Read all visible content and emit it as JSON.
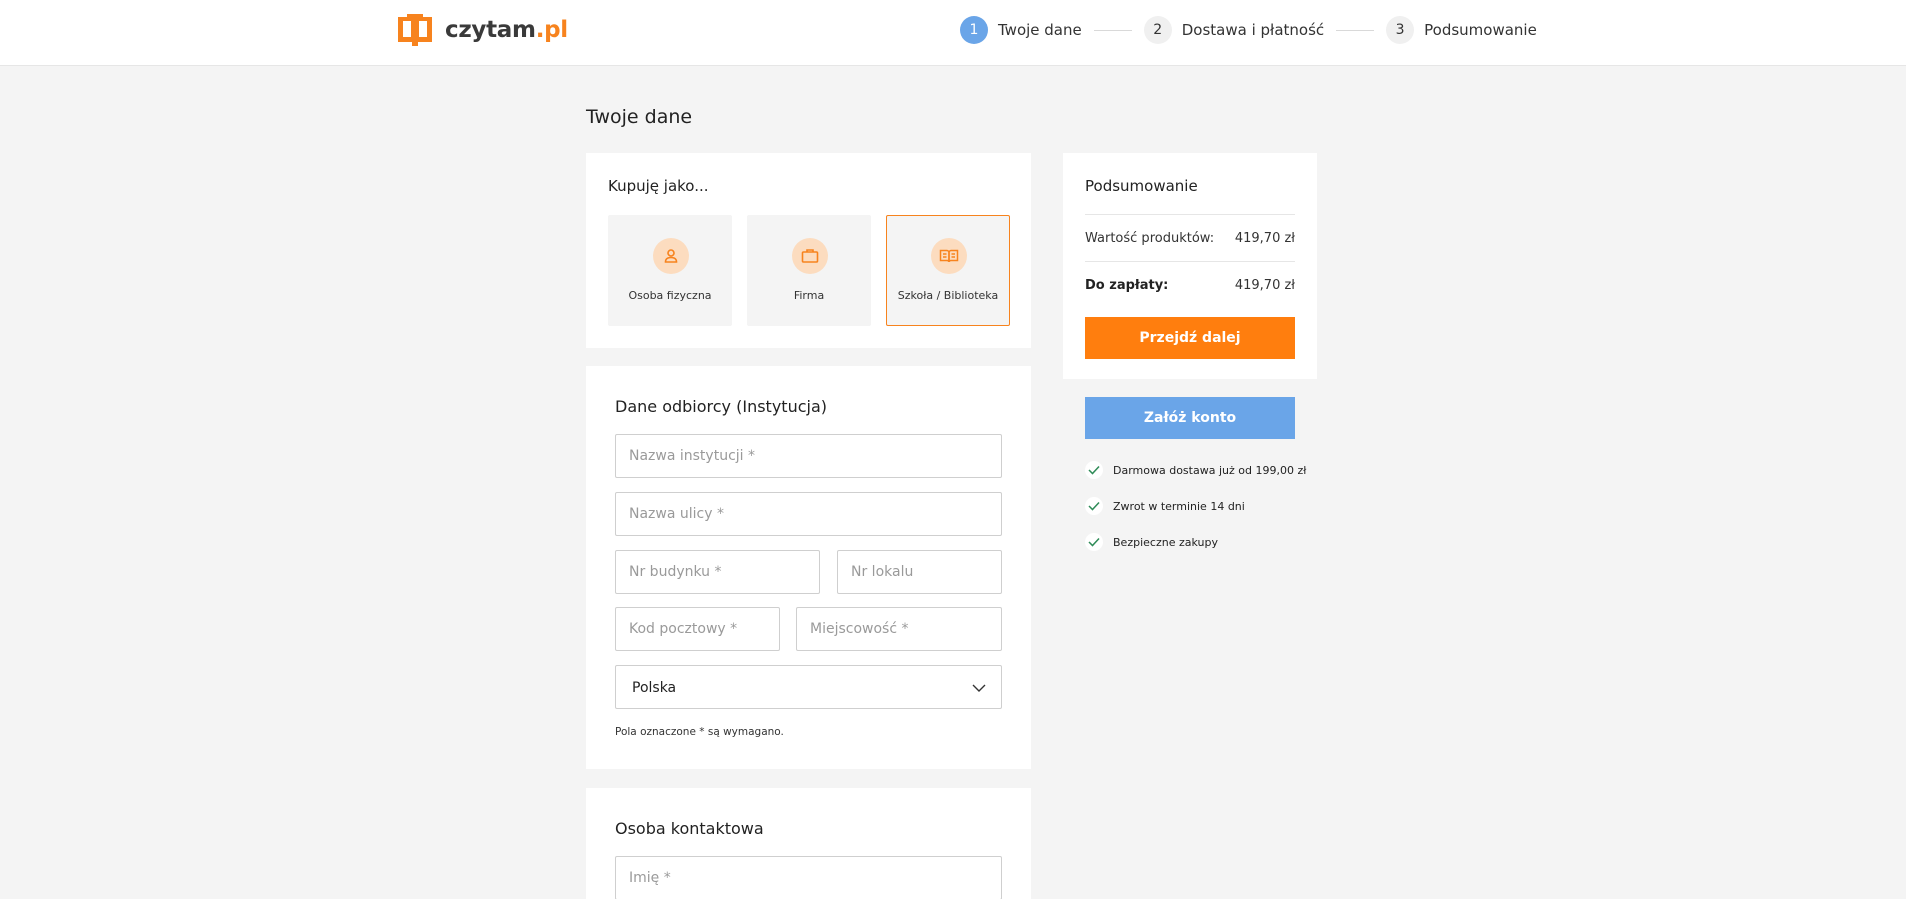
{
  "header": {
    "logo_text": "czytam",
    "logo_tld": ".pl",
    "steps": [
      {
        "num": "1",
        "label": "Twoje dane"
      },
      {
        "num": "2",
        "label": "Dostawa i płatność"
      },
      {
        "num": "3",
        "label": "Podsumowanie"
      }
    ],
    "active_step": 1
  },
  "page": {
    "title": "Twoje dane"
  },
  "buyer": {
    "title": "Kupuję jako...",
    "options": [
      {
        "label": "Osoba fizyczna",
        "icon": "person-icon"
      },
      {
        "label": "Firma",
        "icon": "briefcase-icon"
      },
      {
        "label": "Szkoła / Biblioteka",
        "icon": "open-book-icon"
      }
    ],
    "selected": "Szkoła / Biblioteka"
  },
  "recipient": {
    "title": "Dane odbiorcy (Instytucja)",
    "fields": {
      "institution": "Nazwa instytucji *",
      "street": "Nazwa ulicy *",
      "building": "Nr budynku *",
      "apartment": "Nr lokalu",
      "postal": "Kod pocztowy *",
      "city": "Miejscowość *"
    },
    "country": "Polska",
    "note": "Pola oznaczone * są wymagano."
  },
  "contact": {
    "title": "Osoba kontaktowa",
    "fields": {
      "first_name": "Imię *"
    }
  },
  "summary": {
    "title": "Podsumowanie",
    "products_label": "Wartość produktów:",
    "products_value": "419,70 zł",
    "total_label": "Do zapłaty:",
    "total_value": "419,70 zł",
    "next_button": "Przejdź dalej",
    "account_button": "Załóż konto"
  },
  "perks": [
    "Darmowa dostawa już od 199,00 zł",
    "Zwrot w terminie 14 dni",
    "Bezpieczne zakupy"
  ],
  "colors": {
    "accent": "#ff7e0e",
    "blue": "#6aa5e8",
    "check": "#2e8b57"
  }
}
